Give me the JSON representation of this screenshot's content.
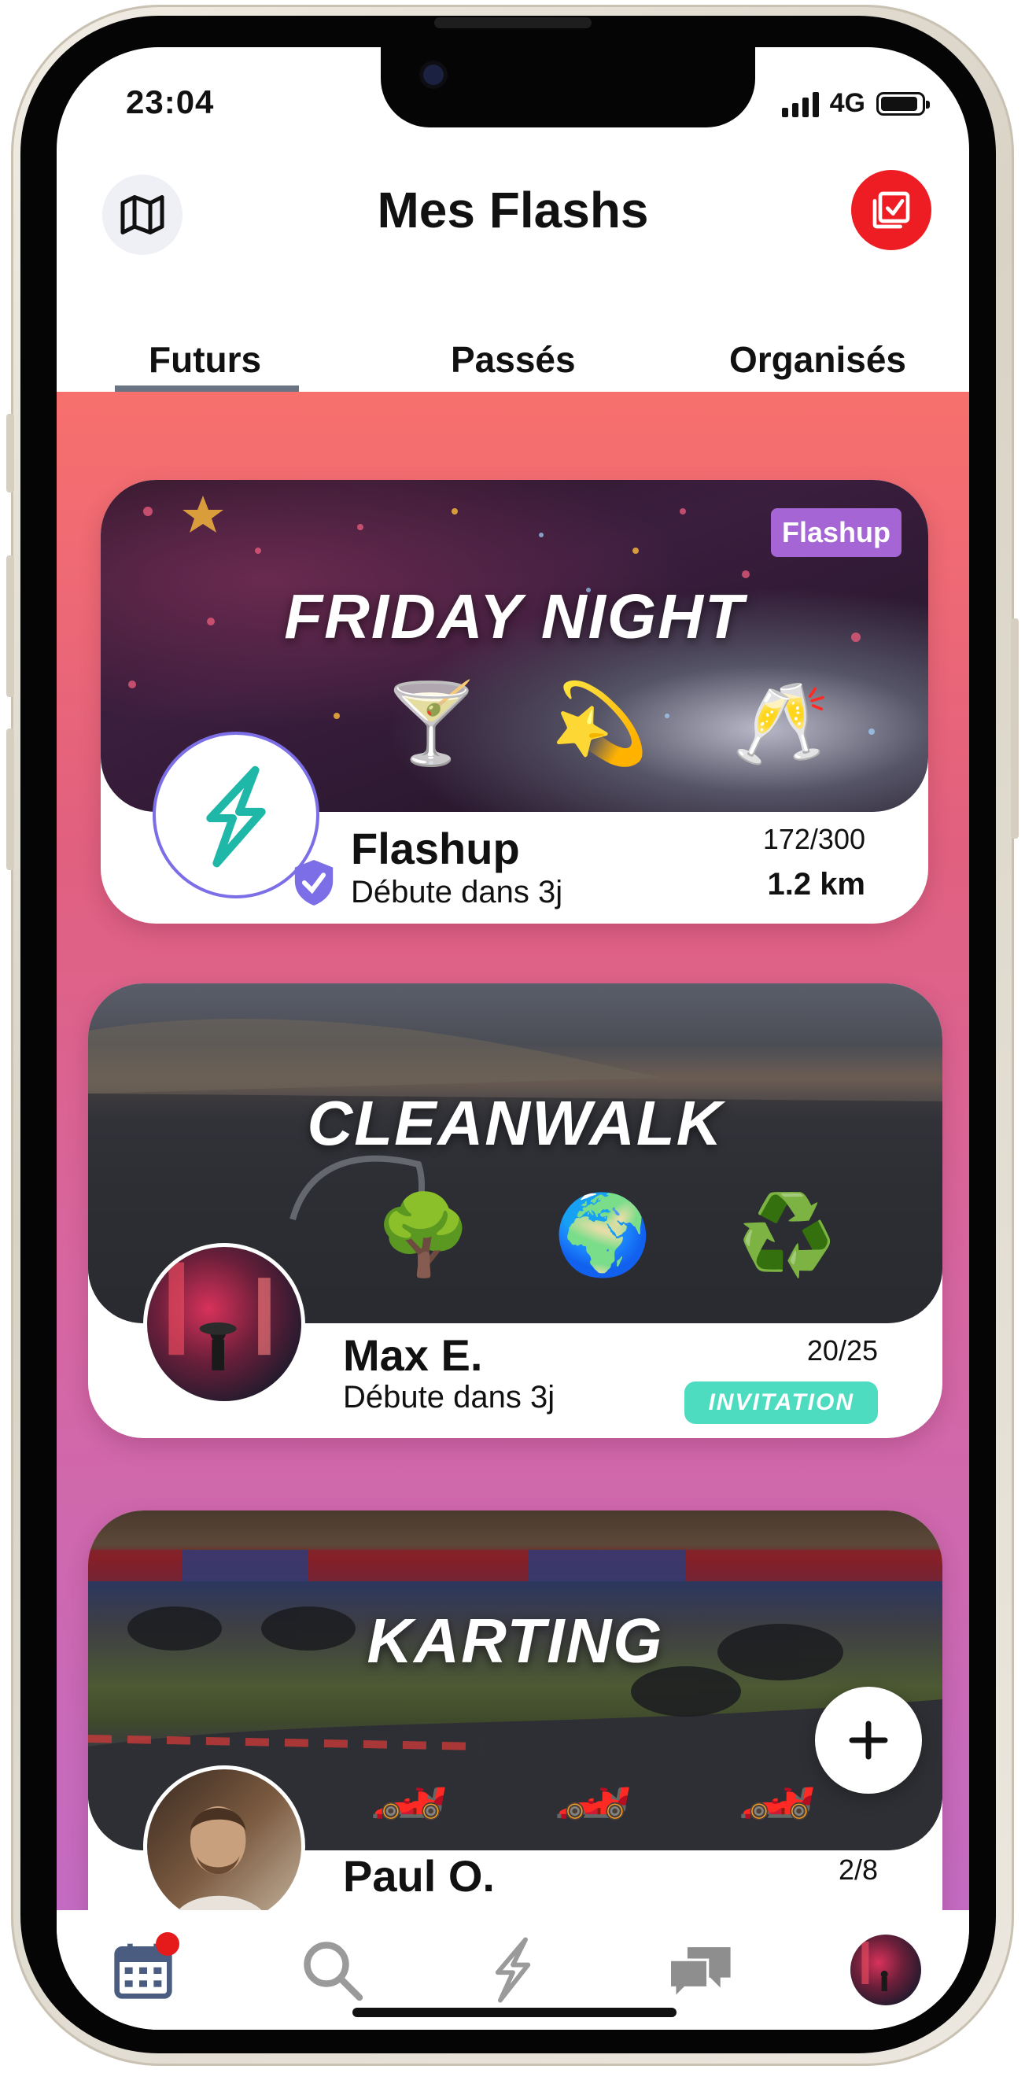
{
  "status_bar": {
    "time": "23:04",
    "network": "4G",
    "signal_bars": 4,
    "battery_level": 0.85
  },
  "header": {
    "title": "Mes Flashs",
    "left_icon": "map-icon",
    "right_icon": "checklist-icon"
  },
  "tabs": [
    {
      "label": "Futurs",
      "active": true
    },
    {
      "label": "Passés",
      "active": false
    },
    {
      "label": "Organisés",
      "active": false
    }
  ],
  "cards": [
    {
      "title": "FRIDAY NIGHT",
      "badge": "Flashup",
      "emojis": [
        "🍸",
        "💫",
        "🥂"
      ],
      "organizer": "Flashup",
      "subtitle": "Débute dans 3j",
      "count": "172/300",
      "distance": "1.2 km",
      "verified": true
    },
    {
      "title": "CLEANWALK",
      "emojis": [
        "🌳",
        "🌍",
        "♻️"
      ],
      "organizer": "Max E.",
      "subtitle": "Débute dans 3j",
      "count": "20/25",
      "tag": "INVITATION"
    },
    {
      "title": "KARTING",
      "emojis": [
        "🏎️",
        "🏎️",
        "🏎️"
      ],
      "organizer": "Paul O.",
      "count": "2/8"
    }
  ],
  "bottom_nav": [
    {
      "name": "calendar",
      "icon": "calendar-icon",
      "notification": true
    },
    {
      "name": "search",
      "icon": "search-icon"
    },
    {
      "name": "flashup",
      "icon": "bolt-icon"
    },
    {
      "name": "messages",
      "icon": "chat-icon"
    },
    {
      "name": "profile",
      "icon": "profile-avatar"
    }
  ],
  "colors": {
    "accent_red": "#ee1d24",
    "badge_purple": "#a565d5",
    "invitation_teal": "#4ddcc0",
    "gradient_top": "#f7706d",
    "gradient_bottom": "#c36bc2"
  }
}
